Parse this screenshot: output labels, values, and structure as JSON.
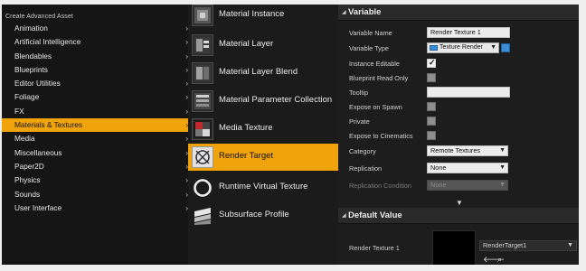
{
  "category_menu": {
    "header": "Create Advanced Asset",
    "items": [
      {
        "label": "Animation",
        "has_submenu": true,
        "selected": false
      },
      {
        "label": "Artificial Intelligence",
        "has_submenu": true,
        "selected": false
      },
      {
        "label": "Blendables",
        "has_submenu": true,
        "selected": false
      },
      {
        "label": "Blueprints",
        "has_submenu": true,
        "selected": false
      },
      {
        "label": "Editor Utilities",
        "has_submenu": true,
        "selected": false
      },
      {
        "label": "Foliage",
        "has_submenu": true,
        "selected": false
      },
      {
        "label": "FX",
        "has_submenu": true,
        "selected": false
      },
      {
        "label": "Materials & Textures",
        "has_submenu": true,
        "selected": true
      },
      {
        "label": "Media",
        "has_submenu": true,
        "selected": false
      },
      {
        "label": "Miscellaneous",
        "has_submenu": true,
        "selected": false
      },
      {
        "label": "Paper2D",
        "has_submenu": true,
        "selected": false
      },
      {
        "label": "Physics",
        "has_submenu": true,
        "selected": false
      },
      {
        "label": "Sounds",
        "has_submenu": true,
        "selected": false
      },
      {
        "label": "User Interface",
        "has_submenu": true,
        "selected": false
      }
    ],
    "chevron": "›",
    "selected_color": "#f0a30a"
  },
  "asset_menu": {
    "items": [
      {
        "label": "Material Instance",
        "icon": "material-instance-icon",
        "selected": false
      },
      {
        "label": "Material Layer",
        "icon": "material-layer-icon",
        "selected": false
      },
      {
        "label": "Material Layer Blend",
        "icon": "material-layer-blend-icon",
        "selected": false
      },
      {
        "label": "Material Parameter Collection",
        "icon": "material-parameter-collection-icon",
        "selected": false
      },
      {
        "label": "Media Texture",
        "icon": "media-texture-icon",
        "selected": false
      },
      {
        "label": "Render Target",
        "icon": "render-target-icon",
        "selected": true
      },
      {
        "label": "Runtime Virtual Texture",
        "icon": "runtime-virtual-texture-icon",
        "selected": false
      },
      {
        "label": "Subsurface Profile",
        "icon": "subsurface-profile-icon",
        "selected": false
      }
    ]
  },
  "details": {
    "variable_section_title": "Variable",
    "default_section_title": "Default Value",
    "props": {
      "variable_name_label": "Variable Name",
      "variable_name_value": "Render Texture 1",
      "variable_type_label": "Variable Type",
      "variable_type_value": "Texture Render",
      "instance_editable_label": "Instance Editable",
      "instance_editable_checked": true,
      "blueprint_read_only_label": "Blueprint Read Only",
      "blueprint_read_only_checked": false,
      "tooltip_label": "Tooltip",
      "tooltip_value": "",
      "expose_on_spawn_label": "Expose on Spawn",
      "expose_on_spawn_checked": false,
      "private_label": "Private",
      "private_checked": false,
      "expose_to_cinematics_label": "Expose to Cinematics",
      "expose_to_cinematics_checked": false,
      "category_label": "Category",
      "category_value": "Remote Textures",
      "replication_label": "Replication",
      "replication_value": "None",
      "replication_condition_label": "Replication Condition",
      "replication_condition_value": "None"
    },
    "default_value": {
      "label": "Render Texture 1",
      "asset_value": "RenderTarget1"
    },
    "glyphs": {
      "section_open": "◢",
      "dropdown": "▼",
      "check": "✓",
      "expand": "▼",
      "back_arrow": "🡐",
      "search": "⌕"
    }
  }
}
